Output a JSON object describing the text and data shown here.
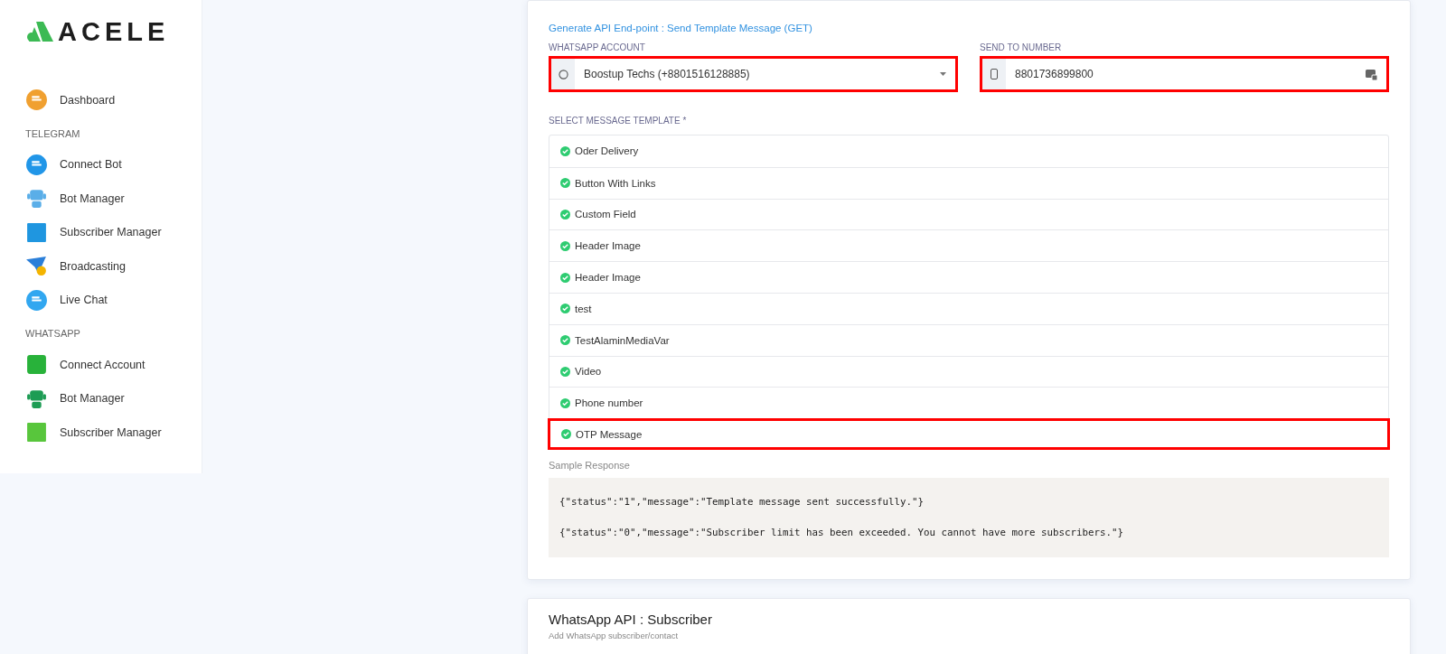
{
  "sidebar": {
    "logo": "ACELE",
    "sections": [
      {
        "items": [
          {
            "label": "Dashboard",
            "kind": "gauge"
          }
        ]
      },
      {
        "heading": "TELEGRAM",
        "items": [
          {
            "label": "Connect Bot",
            "kind": "telegram"
          },
          {
            "label": "Bot Manager",
            "kind": "robot"
          },
          {
            "label": "Subscriber Manager",
            "kind": "contacts"
          },
          {
            "label": "Broadcasting",
            "kind": "plane"
          },
          {
            "label": "Live Chat",
            "kind": "chat"
          }
        ]
      },
      {
        "heading": "WHATSAPP",
        "items": [
          {
            "label": "Connect Account",
            "kind": "whatsapp"
          },
          {
            "label": "Bot Manager",
            "kind": "robotgreen"
          },
          {
            "label": "Subscriber Manager",
            "kind": "contactsgreen"
          }
        ]
      }
    ]
  },
  "api_card": {
    "link": "Generate API End-point : Send Template Message (GET)",
    "account": {
      "label": "WHATSAPP ACCOUNT",
      "value": "Boostup Techs (+8801516128885)",
      "highlighted": true
    },
    "number": {
      "label": "SEND TO NUMBER",
      "value": "8801736899800",
      "highlighted": true
    },
    "templates_label": "SELECT MESSAGE TEMPLATE *",
    "templates": [
      {
        "label": "Oder Delivery",
        "highlighted": false
      },
      {
        "label": "Button With Links",
        "highlighted": false
      },
      {
        "label": "Custom Field",
        "highlighted": false
      },
      {
        "label": "Header Image",
        "highlighted": false
      },
      {
        "label": "Header Image",
        "highlighted": false
      },
      {
        "label": "test",
        "highlighted": false
      },
      {
        "label": "TestAlaminMediaVar",
        "highlighted": false
      },
      {
        "label": "Video",
        "highlighted": false
      },
      {
        "label": "Phone number",
        "highlighted": false
      },
      {
        "label": "OTP Message",
        "highlighted": true
      }
    ],
    "sample_label": "Sample Response",
    "sample_lines": [
      "{\"status\":\"1\",\"message\":\"Template message sent successfully.\"}",
      "{\"status\":\"0\",\"message\":\"Subscriber limit has been exceeded. You cannot have more subscribers.\"}"
    ]
  },
  "subscriber_card": {
    "title": "WhatsApp API : Subscriber",
    "subtitle": "Add WhatsApp subscriber/contact"
  }
}
